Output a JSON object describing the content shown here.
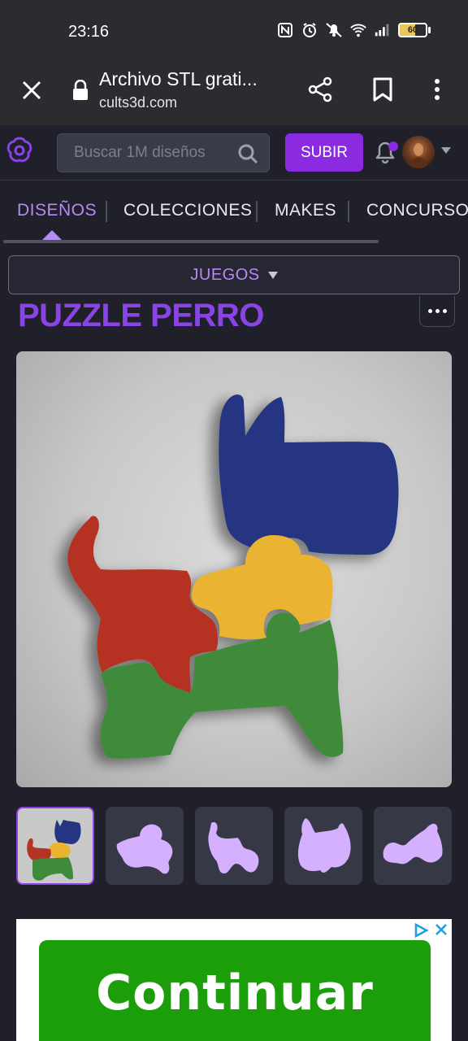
{
  "status_bar": {
    "time": "23:16",
    "battery": "60",
    "icons": [
      "nfc-icon",
      "alarm-icon",
      "mute-icon",
      "wifi-icon",
      "signal-icon",
      "battery-icon"
    ]
  },
  "browser": {
    "page_title": "Archivo STL grati...",
    "domain": "cults3d.com"
  },
  "header": {
    "search_placeholder": "Buscar 1M diseños",
    "upload_label": "SUBIR"
  },
  "tabs": [
    {
      "label": "DISEÑOS",
      "active": true
    },
    {
      "label": "COLECCIONES",
      "active": false
    },
    {
      "label": "MAKES",
      "active": false
    },
    {
      "label": "CONCURSOS",
      "active": false
    }
  ],
  "category": {
    "label": "JUEGOS"
  },
  "product": {
    "title": "PUZZLE PERRO"
  },
  "ad": {
    "cta_label": "Continuar"
  },
  "colors": {
    "accent": "#8a2be2",
    "title": "#8a44e6",
    "puzzle_blue": "#253582",
    "puzzle_yellow": "#eab430",
    "puzzle_red": "#b53324",
    "puzzle_green": "#3f8b3a",
    "thumb_shape": "#d4b0ff",
    "ad_green": "#1c9e0a"
  }
}
